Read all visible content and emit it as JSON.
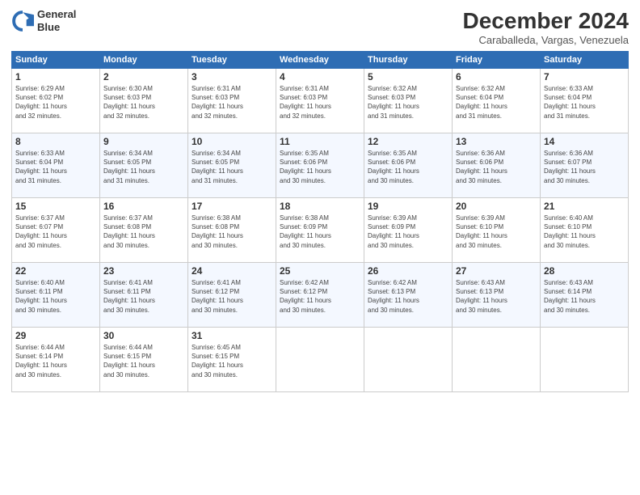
{
  "header": {
    "logo_line1": "General",
    "logo_line2": "Blue",
    "month": "December 2024",
    "location": "Caraballeda, Vargas, Venezuela"
  },
  "weekdays": [
    "Sunday",
    "Monday",
    "Tuesday",
    "Wednesday",
    "Thursday",
    "Friday",
    "Saturday"
  ],
  "weeks": [
    [
      {
        "day": "1",
        "info": "Sunrise: 6:29 AM\nSunset: 6:02 PM\nDaylight: 11 hours\nand 32 minutes."
      },
      {
        "day": "2",
        "info": "Sunrise: 6:30 AM\nSunset: 6:03 PM\nDaylight: 11 hours\nand 32 minutes."
      },
      {
        "day": "3",
        "info": "Sunrise: 6:31 AM\nSunset: 6:03 PM\nDaylight: 11 hours\nand 32 minutes."
      },
      {
        "day": "4",
        "info": "Sunrise: 6:31 AM\nSunset: 6:03 PM\nDaylight: 11 hours\nand 32 minutes."
      },
      {
        "day": "5",
        "info": "Sunrise: 6:32 AM\nSunset: 6:03 PM\nDaylight: 11 hours\nand 31 minutes."
      },
      {
        "day": "6",
        "info": "Sunrise: 6:32 AM\nSunset: 6:04 PM\nDaylight: 11 hours\nand 31 minutes."
      },
      {
        "day": "7",
        "info": "Sunrise: 6:33 AM\nSunset: 6:04 PM\nDaylight: 11 hours\nand 31 minutes."
      }
    ],
    [
      {
        "day": "8",
        "info": "Sunrise: 6:33 AM\nSunset: 6:04 PM\nDaylight: 11 hours\nand 31 minutes."
      },
      {
        "day": "9",
        "info": "Sunrise: 6:34 AM\nSunset: 6:05 PM\nDaylight: 11 hours\nand 31 minutes."
      },
      {
        "day": "10",
        "info": "Sunrise: 6:34 AM\nSunset: 6:05 PM\nDaylight: 11 hours\nand 31 minutes."
      },
      {
        "day": "11",
        "info": "Sunrise: 6:35 AM\nSunset: 6:06 PM\nDaylight: 11 hours\nand 30 minutes."
      },
      {
        "day": "12",
        "info": "Sunrise: 6:35 AM\nSunset: 6:06 PM\nDaylight: 11 hours\nand 30 minutes."
      },
      {
        "day": "13",
        "info": "Sunrise: 6:36 AM\nSunset: 6:06 PM\nDaylight: 11 hours\nand 30 minutes."
      },
      {
        "day": "14",
        "info": "Sunrise: 6:36 AM\nSunset: 6:07 PM\nDaylight: 11 hours\nand 30 minutes."
      }
    ],
    [
      {
        "day": "15",
        "info": "Sunrise: 6:37 AM\nSunset: 6:07 PM\nDaylight: 11 hours\nand 30 minutes."
      },
      {
        "day": "16",
        "info": "Sunrise: 6:37 AM\nSunset: 6:08 PM\nDaylight: 11 hours\nand 30 minutes."
      },
      {
        "day": "17",
        "info": "Sunrise: 6:38 AM\nSunset: 6:08 PM\nDaylight: 11 hours\nand 30 minutes."
      },
      {
        "day": "18",
        "info": "Sunrise: 6:38 AM\nSunset: 6:09 PM\nDaylight: 11 hours\nand 30 minutes."
      },
      {
        "day": "19",
        "info": "Sunrise: 6:39 AM\nSunset: 6:09 PM\nDaylight: 11 hours\nand 30 minutes."
      },
      {
        "day": "20",
        "info": "Sunrise: 6:39 AM\nSunset: 6:10 PM\nDaylight: 11 hours\nand 30 minutes."
      },
      {
        "day": "21",
        "info": "Sunrise: 6:40 AM\nSunset: 6:10 PM\nDaylight: 11 hours\nand 30 minutes."
      }
    ],
    [
      {
        "day": "22",
        "info": "Sunrise: 6:40 AM\nSunset: 6:11 PM\nDaylight: 11 hours\nand 30 minutes."
      },
      {
        "day": "23",
        "info": "Sunrise: 6:41 AM\nSunset: 6:11 PM\nDaylight: 11 hours\nand 30 minutes."
      },
      {
        "day": "24",
        "info": "Sunrise: 6:41 AM\nSunset: 6:12 PM\nDaylight: 11 hours\nand 30 minutes."
      },
      {
        "day": "25",
        "info": "Sunrise: 6:42 AM\nSunset: 6:12 PM\nDaylight: 11 hours\nand 30 minutes."
      },
      {
        "day": "26",
        "info": "Sunrise: 6:42 AM\nSunset: 6:13 PM\nDaylight: 11 hours\nand 30 minutes."
      },
      {
        "day": "27",
        "info": "Sunrise: 6:43 AM\nSunset: 6:13 PM\nDaylight: 11 hours\nand 30 minutes."
      },
      {
        "day": "28",
        "info": "Sunrise: 6:43 AM\nSunset: 6:14 PM\nDaylight: 11 hours\nand 30 minutes."
      }
    ],
    [
      {
        "day": "29",
        "info": "Sunrise: 6:44 AM\nSunset: 6:14 PM\nDaylight: 11 hours\nand 30 minutes."
      },
      {
        "day": "30",
        "info": "Sunrise: 6:44 AM\nSunset: 6:15 PM\nDaylight: 11 hours\nand 30 minutes."
      },
      {
        "day": "31",
        "info": "Sunrise: 6:45 AM\nSunset: 6:15 PM\nDaylight: 11 hours\nand 30 minutes."
      },
      null,
      null,
      null,
      null
    ]
  ]
}
